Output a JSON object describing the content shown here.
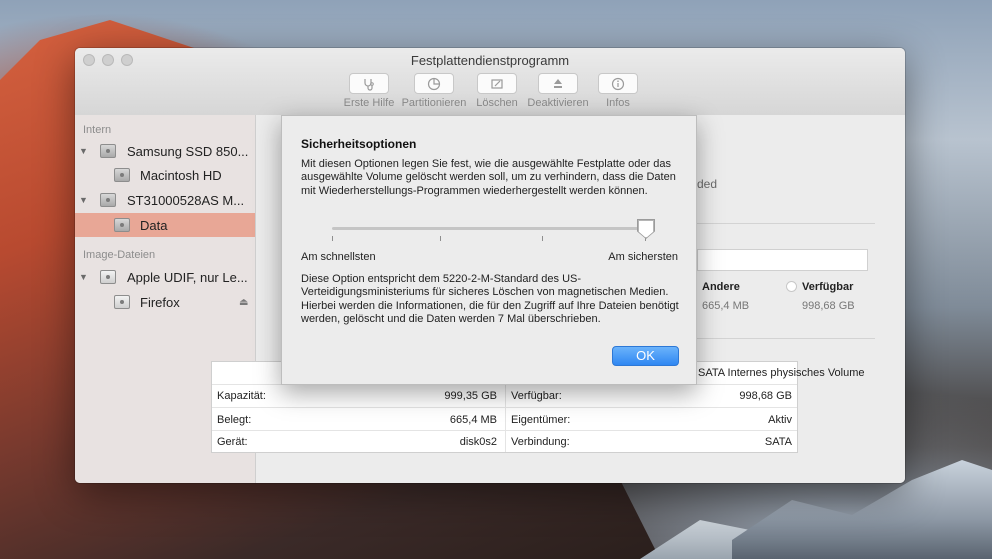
{
  "window": {
    "title": "Festplattendienstprogramm"
  },
  "toolbar": {
    "items": [
      {
        "label": "Erste Hilfe",
        "icon": "stethoscope-icon"
      },
      {
        "label": "Partitionieren",
        "icon": "pie-partition-icon"
      },
      {
        "label": "Löschen",
        "icon": "erase-icon"
      },
      {
        "label": "Deaktivieren",
        "icon": "eject-unmount-icon"
      },
      {
        "label": "Infos",
        "icon": "info-icon"
      }
    ]
  },
  "sidebar": {
    "sections": [
      {
        "title": "Intern"
      },
      {
        "title": "Image-Dateien"
      }
    ],
    "items": [
      {
        "label": "Samsung SSD 850..."
      },
      {
        "label": "Macintosh HD"
      },
      {
        "label": "ST31000528AS M..."
      },
      {
        "label": "Data"
      },
      {
        "label": "Apple UDIF, nur Le..."
      },
      {
        "label": "Firefox"
      }
    ]
  },
  "background_pane": {
    "partial_text": "ded",
    "legend": [
      {
        "label": "Andere",
        "value": "665,4 MB"
      },
      {
        "label": "Verfügbar",
        "value": "998,68 GB"
      }
    ],
    "header_fragment": "SATA Internes physisches Volume",
    "info_rows": [
      {
        "left_label": "Kapazität:",
        "left_value": "999,35 GB",
        "right_label": "Verfügbar:",
        "right_value": "998,68 GB"
      },
      {
        "left_label": "Belegt:",
        "left_value": "665,4 MB",
        "right_label": "Eigentümer:",
        "right_value": "Aktiv"
      },
      {
        "left_label": "Gerät:",
        "left_value": "disk0s2",
        "right_label": "Verbindung:",
        "right_value": "SATA"
      }
    ]
  },
  "dialog": {
    "title": "Sicherheitsoptionen",
    "description": "Mit diesen Optionen legen Sie fest, wie die ausgewählte Festplatte oder das ausgewählte Volume gelöscht werden soll, um zu verhindern, dass die Daten mit Wiederherstellungs-Programmen wiederhergestellt werden können.",
    "slider_min_label": "Am schnellsten",
    "slider_max_label": "Am sichersten",
    "slider_level": 1.0,
    "detail": "Diese Option entspricht dem 5220-2-M-Standard des US-Verteidigungsministeriums für sicheres Löschen von magnetischen Medien. Hierbei werden die Informationen, die für den Zugriff auf Ihre Dateien benötigt werden, gelöscht und die Daten werden 7 Mal überschrieben.",
    "ok_label": "OK"
  },
  "colors": {
    "accent": "#2f87f2",
    "selection": "#e8a796"
  }
}
